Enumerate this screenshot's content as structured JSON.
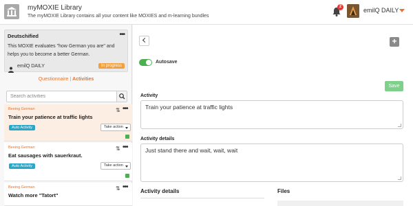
{
  "header": {
    "title": "myMOXIE Library",
    "subtitle": "The myMOXIE Library contains all your content like MOXIES and m-learning bundles",
    "notifications_count": "2",
    "user_name": "emilQ DAILY"
  },
  "module": {
    "title": "Deutschified",
    "description": "This MOXIE evaluates \"how German you are\" and helps you to become a better German.",
    "user": "emilQ DAILY",
    "status": "In progress"
  },
  "tabs": {
    "questionnaire": "Questionnaire",
    "separator": "|",
    "activities": "Activities"
  },
  "search": {
    "placeholder": "Search activities"
  },
  "activities": [
    {
      "category": "Beeing German",
      "title": "Train your patience at traffic lights",
      "badge": "Auto Activity",
      "action": "Take action"
    },
    {
      "category": "Beeing German",
      "title": "Eat sausages with sauerkraut.",
      "badge": "Auto Activity",
      "action": "Take action"
    },
    {
      "category": "Beeing German",
      "title": "Watch more \"Tatort\""
    }
  ],
  "editor": {
    "autosave_label": "Autosave",
    "save_label": "Save",
    "activity_label": "Activity",
    "activity_value": "Train your patience at traffic lights",
    "details_label": "Activity details",
    "details_value": "Just stand there and wait, wait, wait",
    "section_details": "Activity details",
    "section_files": "Files"
  },
  "colors": {
    "accent": "#e8732a",
    "auto_badge": "#2aa6c8",
    "toggle_on": "#4caf50",
    "save_button": "#7ed08a",
    "progress_badge": "#f2a03d",
    "notification_badge": "#e53935"
  },
  "icons": {
    "logo": "library-icon",
    "bell": "bell-icon",
    "search": "search-icon",
    "user": "person-icon",
    "sort": "sort-arrows-icon",
    "back": "chevron-left-icon",
    "add": "plus-icon"
  }
}
